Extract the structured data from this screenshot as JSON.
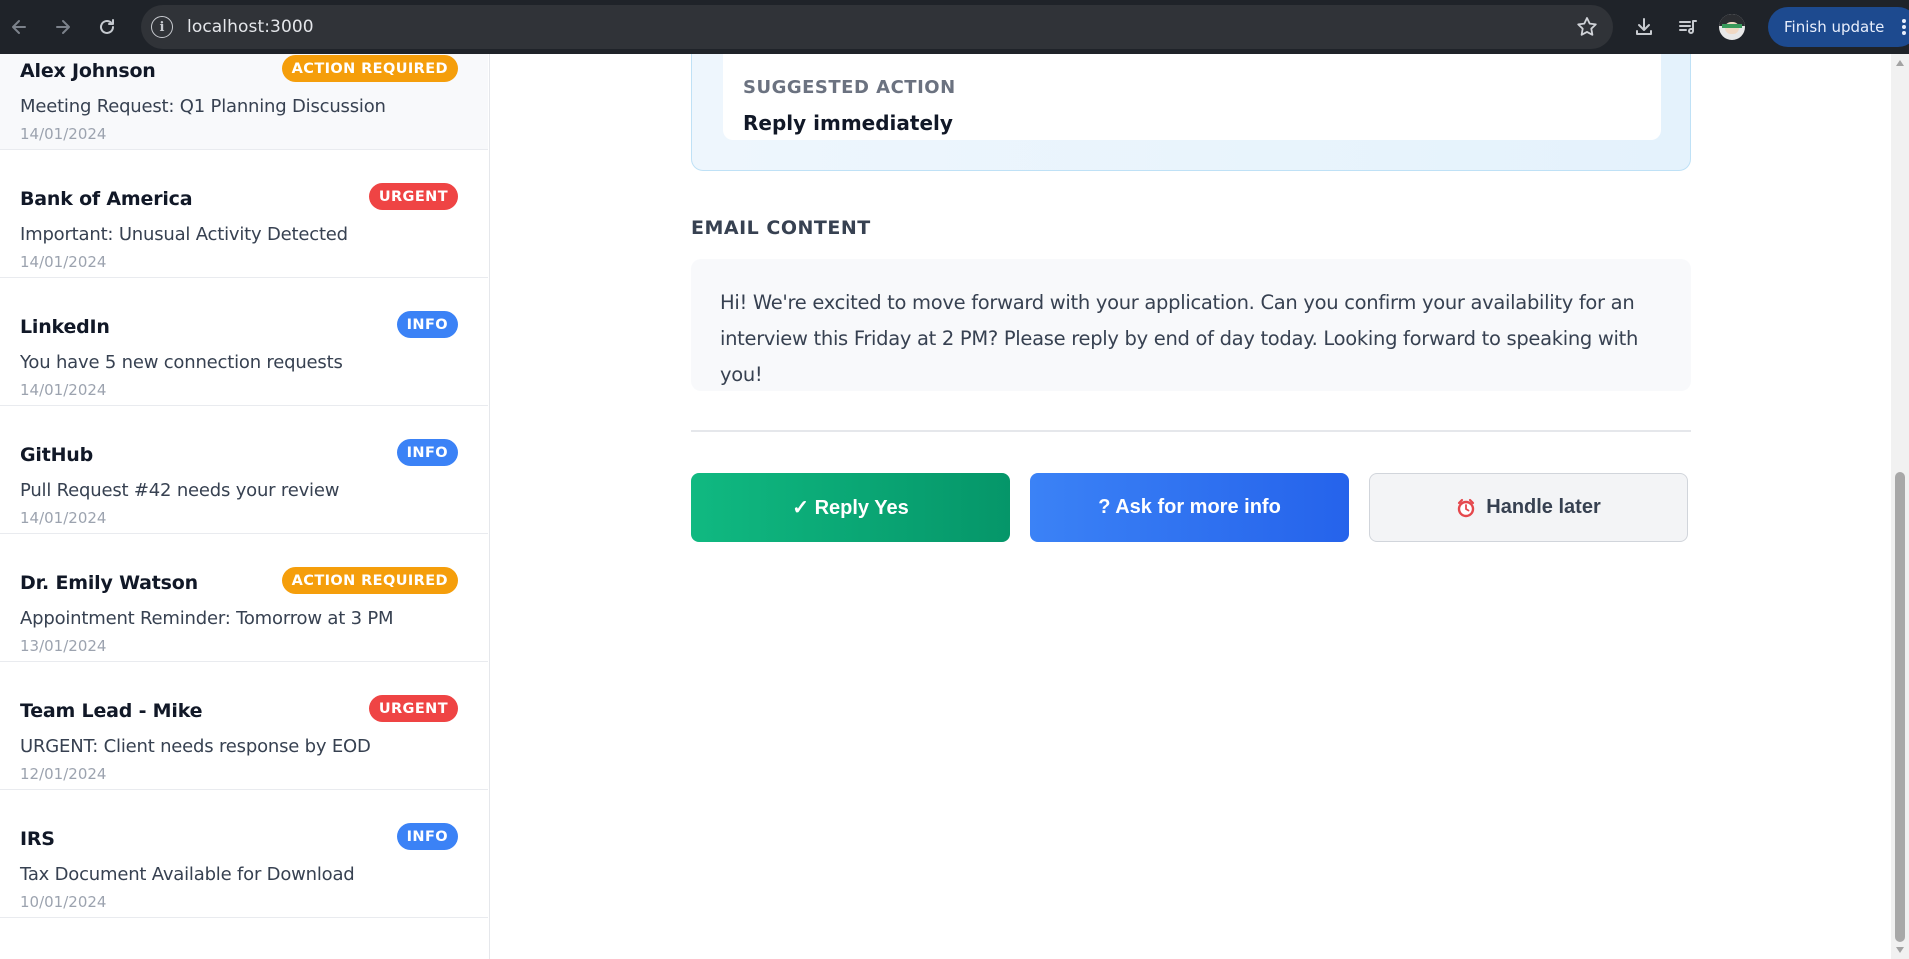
{
  "browser": {
    "url": "localhost:3000",
    "finish_update_label": "Finish update",
    "icons": [
      "back-arrow-icon",
      "forward-arrow-icon",
      "reload-icon",
      "site-info-icon",
      "bookmark-star-icon",
      "download-icon",
      "reading-list-icon",
      "profile-avatar",
      "kebab-menu-icon"
    ]
  },
  "emails": [
    {
      "sender": "Alex Johnson",
      "subject": "Meeting Request: Q1 Planning Discussion",
      "date": "14/01/2024",
      "badge": "ACTION REQUIRED",
      "badge_type": "action"
    },
    {
      "sender": "Bank of America",
      "subject": "Important: Unusual Activity Detected",
      "date": "14/01/2024",
      "badge": "URGENT",
      "badge_type": "urgent"
    },
    {
      "sender": "LinkedIn",
      "subject": "You have 5 new connection requests",
      "date": "14/01/2024",
      "badge": "INFO",
      "badge_type": "info"
    },
    {
      "sender": "GitHub",
      "subject": "Pull Request #42 needs your review",
      "date": "14/01/2024",
      "badge": "INFO",
      "badge_type": "info"
    },
    {
      "sender": "Dr. Emily Watson",
      "subject": "Appointment Reminder: Tomorrow at 3 PM",
      "date": "13/01/2024",
      "badge": "ACTION REQUIRED",
      "badge_type": "action"
    },
    {
      "sender": "Team Lead - Mike",
      "subject": "URGENT: Client needs response by EOD",
      "date": "12/01/2024",
      "badge": "URGENT",
      "badge_type": "urgent"
    },
    {
      "sender": "IRS",
      "subject": "Tax Document Available for Download",
      "date": "10/01/2024",
      "badge": "INFO",
      "badge_type": "info"
    }
  ],
  "detail": {
    "suggested_action_label": "SUGGESTED ACTION",
    "suggested_action_value": "Reply immediately",
    "email_content_title": "EMAIL CONTENT",
    "email_body": "Hi! We're excited to move forward with your application. Can you confirm your availability for an interview this Friday at 2 PM? Please reply by end of day today. Looking forward to speaking with you!",
    "buttons": {
      "reply_yes": "✓ Reply Yes",
      "ask_more_info": "? Ask for more info",
      "handle_later": "Handle later"
    }
  },
  "colors": {
    "badge_action": "#f59e0b",
    "badge_urgent": "#ef4444",
    "badge_info": "#3b82f6",
    "reply_yes": "#10b981",
    "ask_more": "#3b82f6"
  }
}
